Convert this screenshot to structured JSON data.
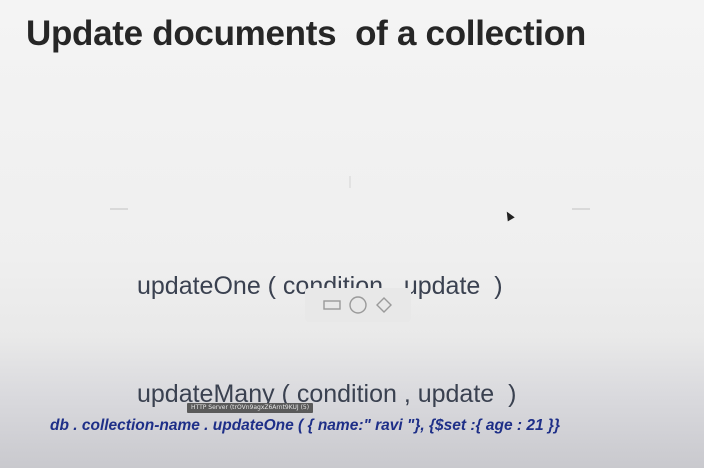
{
  "slide": {
    "title": "Update documents  of a collection",
    "methods": [
      "updateOne ( condition , update  )",
      "updateMany ( condition , update  )"
    ],
    "shape_tools": [
      "rectangle-icon",
      "circle-icon",
      "diamond-icon"
    ],
    "tooltip": "HTTP Server (trOVn9agxZ6Arnt9KUJ (5)",
    "code_example": "db . collection-name . updateOne ( { name:\" ravi \"}, {$set :{ age : 21 }}"
  },
  "colors": {
    "title": "#262626",
    "methods": "#3a4150",
    "code": "#1e2f88"
  }
}
